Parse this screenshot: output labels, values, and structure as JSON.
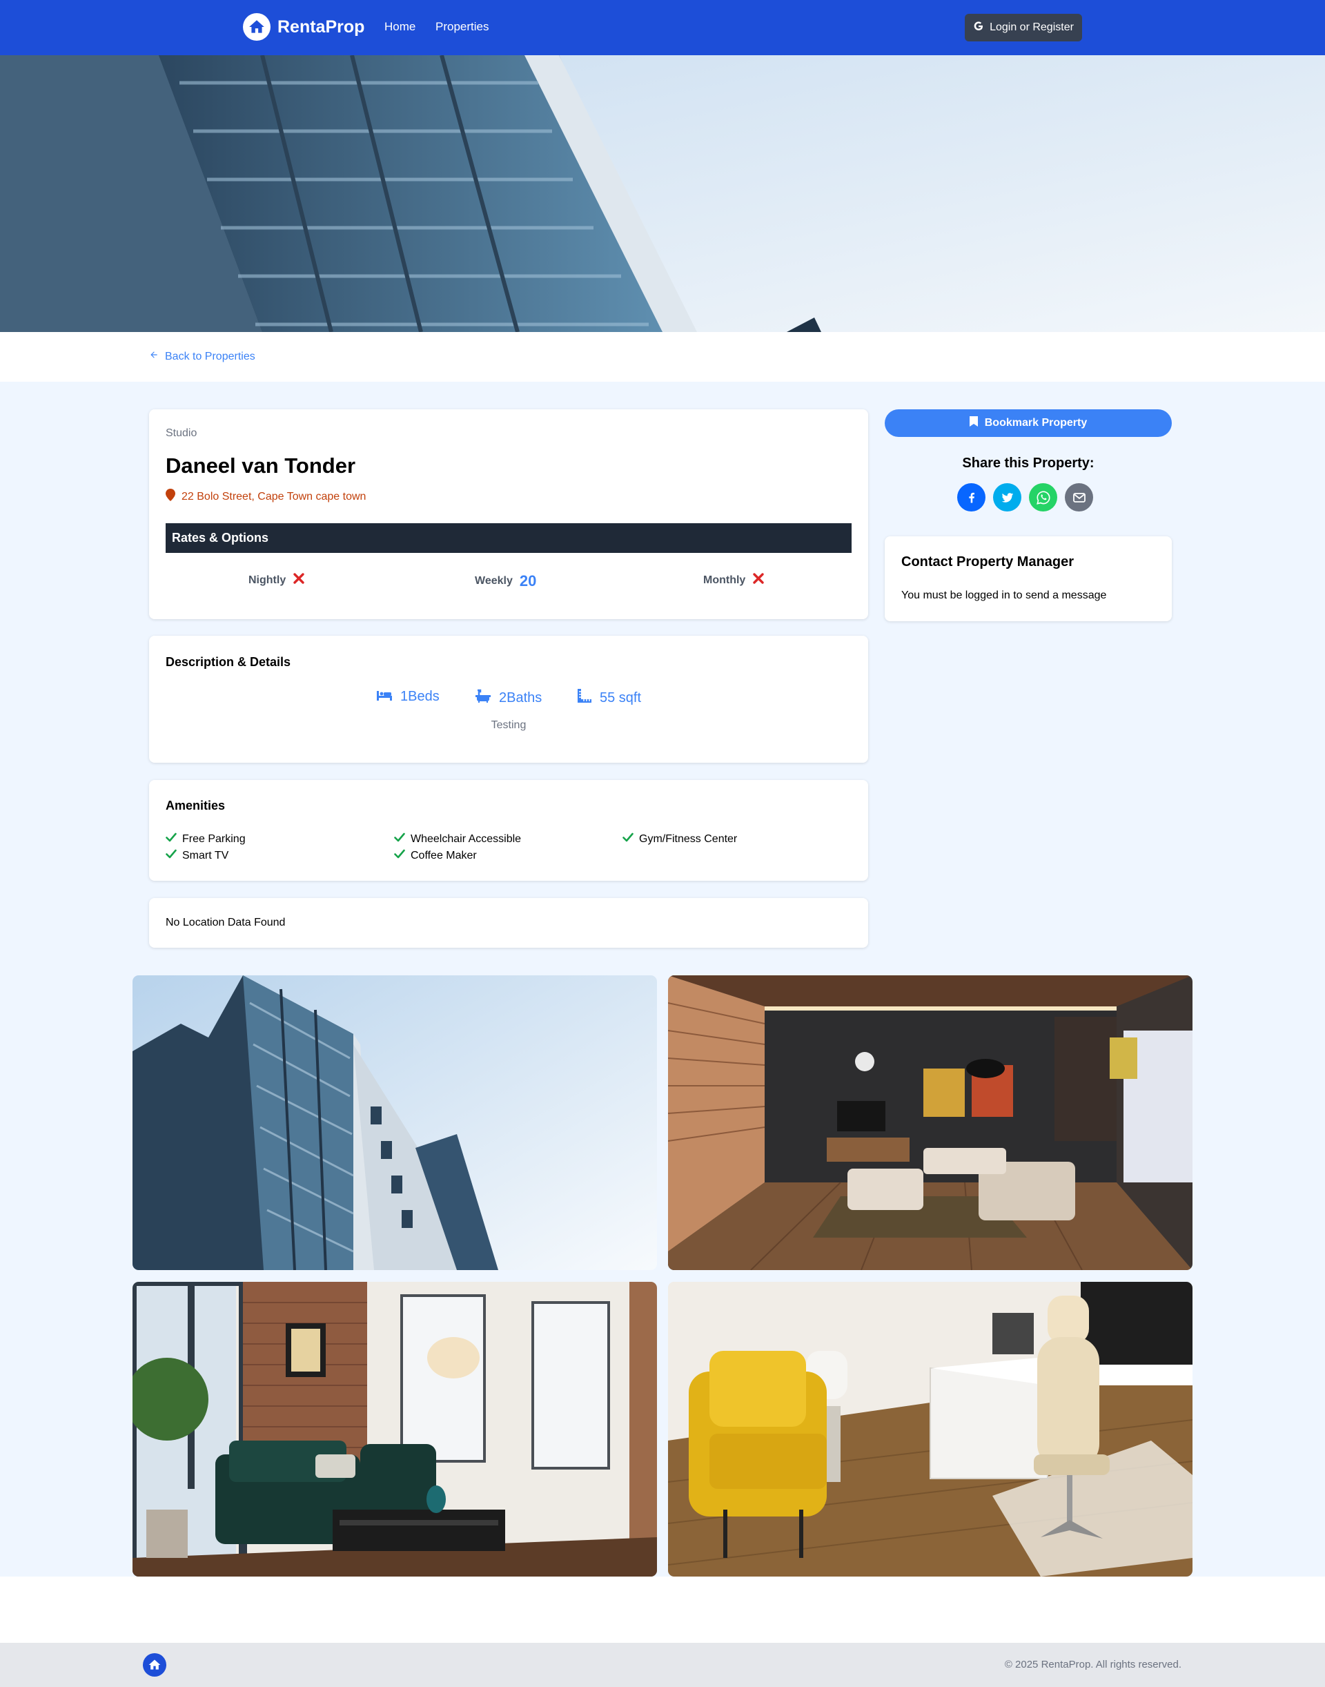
{
  "nav": {
    "brand": "RentaProp",
    "links": [
      "Home",
      "Properties"
    ],
    "login_label": "Login or Register"
  },
  "back_label": "Back to Properties",
  "property": {
    "type": "Studio",
    "name": "Daneel van Tonder",
    "address": "22 Bolo Street, Cape Town cape town"
  },
  "rates": {
    "title": "Rates & Options",
    "nightly": {
      "label": "Nightly",
      "value": null
    },
    "weekly": {
      "label": "Weekly",
      "value": "20"
    },
    "monthly": {
      "label": "Monthly",
      "value": null
    }
  },
  "details": {
    "title": "Description & Details",
    "beds": "1Beds",
    "baths": "2Baths",
    "sqft": "55 sqft",
    "description": "Testing"
  },
  "amenities": {
    "title": "Amenities",
    "items": [
      "Free Parking",
      "Wheelchair Accessible",
      "Gym/Fitness Center",
      "Smart TV",
      "Coffee Maker"
    ]
  },
  "location": {
    "message": "No Location Data Found"
  },
  "sidebar": {
    "bookmark_label": "Bookmark Property",
    "share_title": "Share this Property:",
    "share_icons": [
      "facebook-icon",
      "twitter-icon",
      "whatsapp-icon",
      "email-icon"
    ],
    "contact_title": "Contact Property Manager",
    "contact_message": "You must be logged in to send a message"
  },
  "gallery": {
    "images": [
      "building-exterior",
      "living-room-wood",
      "living-room-brick",
      "office-yellow-chair"
    ]
  },
  "footer": {
    "copyright": "© 2025 RentaProp. All rights reserved."
  },
  "colors": {
    "nav": "#1d4ed8",
    "accent": "#3b82f6",
    "address": "#c2410c",
    "dark_bar": "#1f2937",
    "page_bg": "#eff6ff",
    "check": "#16a34a",
    "cross": "#dc2626"
  }
}
